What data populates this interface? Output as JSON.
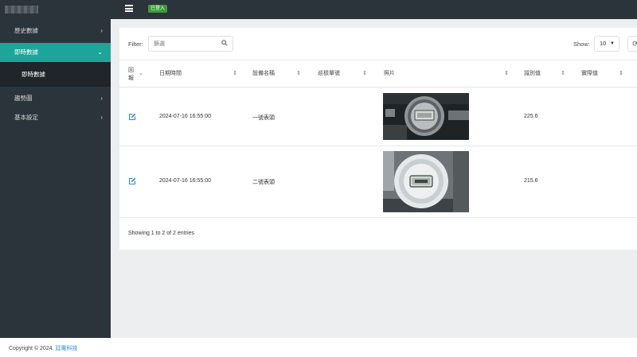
{
  "header": {
    "login_badge": "已登入"
  },
  "sidebar": {
    "items": [
      {
        "label": "歷史數據",
        "chevron": "›"
      },
      {
        "label": "即時數據",
        "chevron": "⌄"
      },
      {
        "label": "即時數據"
      },
      {
        "label": "趨勢圖",
        "chevron": "›"
      },
      {
        "label": "基本設定",
        "chevron": "›"
      }
    ]
  },
  "filter": {
    "label": "Filter:",
    "placeholder": "篩選"
  },
  "show": {
    "label": "Show:",
    "value": "10"
  },
  "table": {
    "columns": [
      "回報",
      "日期時間",
      "設備名稱",
      "巡檢單號",
      "照片",
      "識別值",
      "實際值"
    ],
    "rows": [
      {
        "datetime": "2024-07-16 16:55:00",
        "device": "一號表頭",
        "inspection_no": "",
        "recognized": "225.6",
        "actual": ""
      },
      {
        "datetime": "2024-07-16 16:55:00",
        "device": "二號表頭",
        "inspection_no": "",
        "recognized": "215.6",
        "actual": ""
      }
    ]
  },
  "info": "Showing 1 to 2 of 2 entries",
  "footer": {
    "prefix": "Copyright © 2024.",
    "company": "廷電科技"
  },
  "colors": {
    "accent": "#1ea59a",
    "sidebar": "#2c343b",
    "badge": "#3c9a3d",
    "link": "#2e8bd6"
  },
  "icons": {
    "edit": "edit-icon",
    "search": "search-icon",
    "refresh": "refresh-icon",
    "menu": "hamburger-icon"
  }
}
